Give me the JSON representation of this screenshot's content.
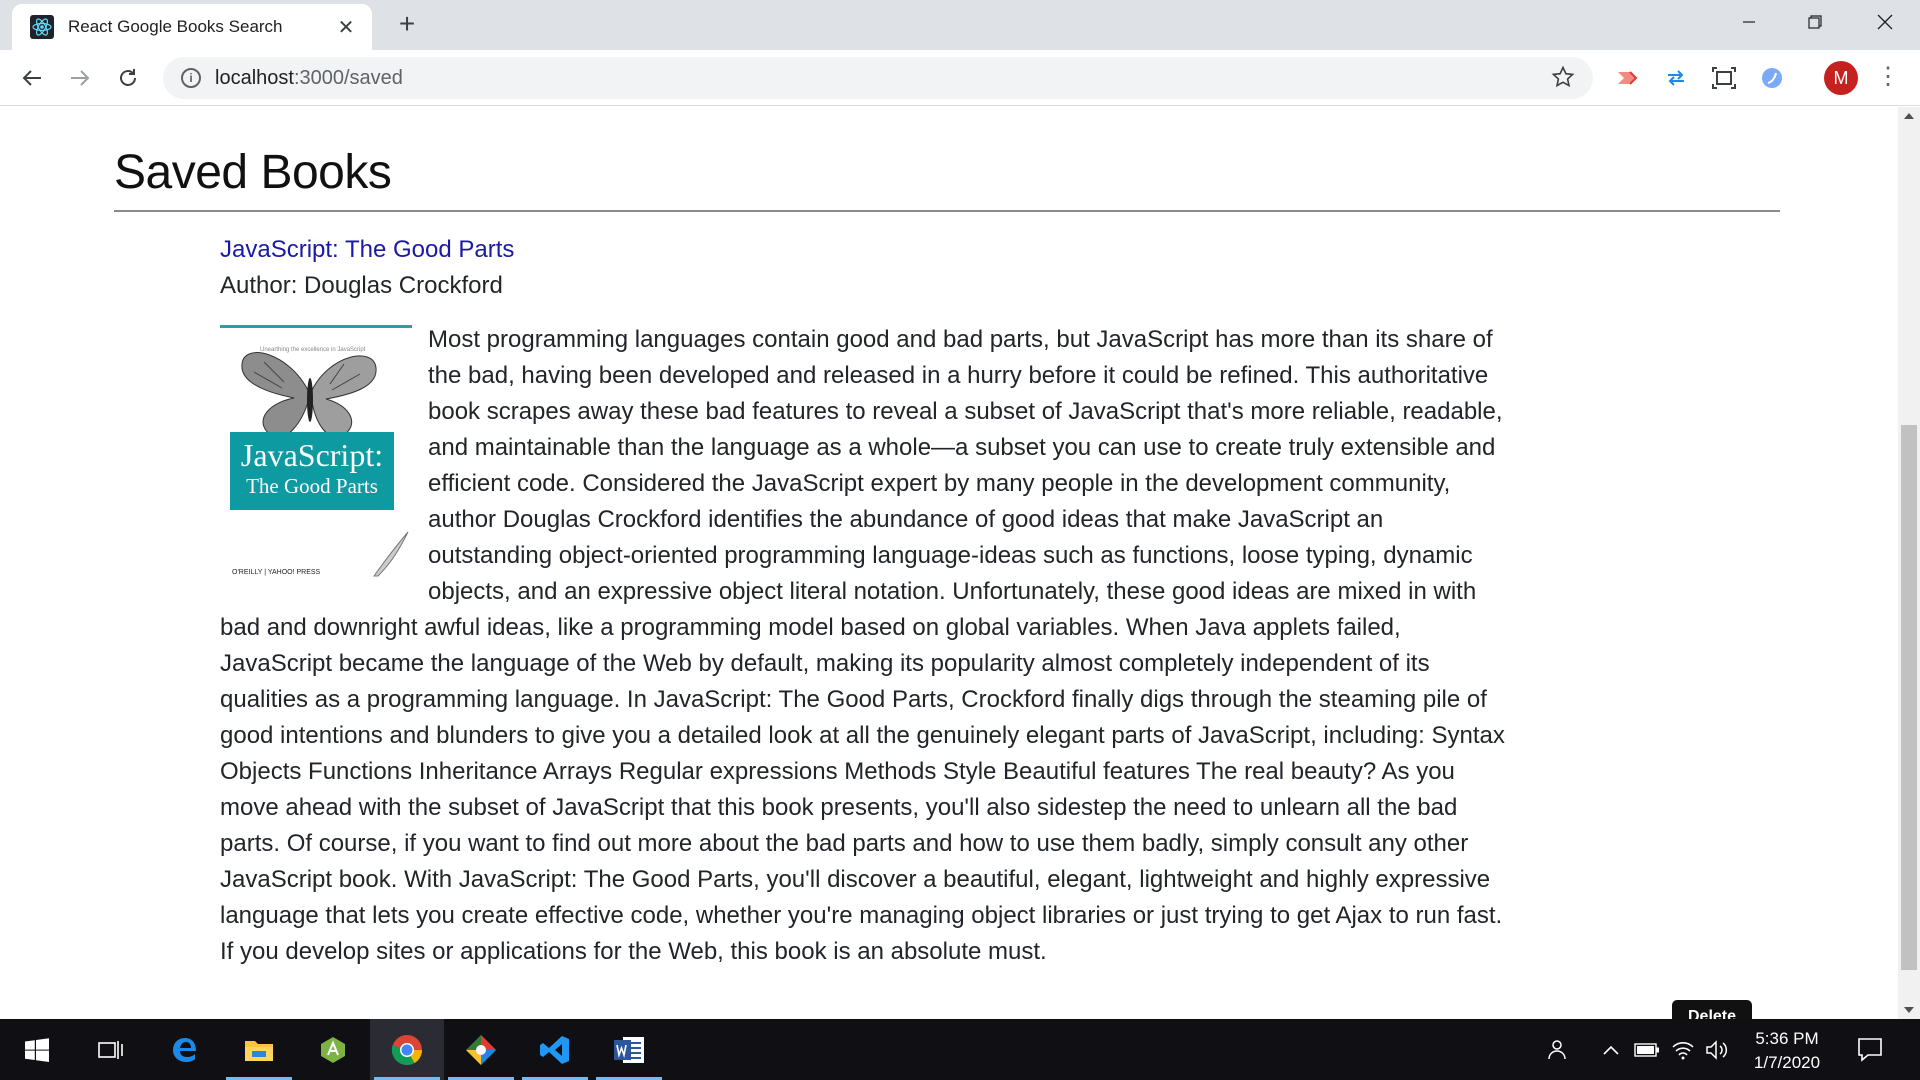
{
  "browser": {
    "tab_title": "React Google Books Search",
    "tab_close": "✕",
    "new_tab": "+",
    "url_host": "localhost",
    "url_path": ":3000/saved",
    "profile_initial": "M",
    "win_minimize": "—",
    "win_restore": "❐",
    "win_close": "✕"
  },
  "page": {
    "title": "Saved Books",
    "tooltip": "Delete"
  },
  "book": {
    "title": "JavaScript: The Good Parts",
    "author": "Author: Douglas Crockford",
    "cover": {
      "tagline": "Unearthing the excellence in JavaScript",
      "line1": "JavaScript:",
      "line2": "The Good Parts",
      "publisher": "O'REILLY | YAHOO! PRESS"
    },
    "description": "Most programming languages contain good and bad parts, but JavaScript has more than its share of the bad, having been developed and released in a hurry before it could be refined. This authoritative book scrapes away these bad features to reveal a subset of JavaScript that's more reliable, readable, and maintainable than the language as a whole—a subset you can use to create truly extensible and efficient code. Considered the JavaScript expert by many people in the development community, author Douglas Crockford identifies the abundance of good ideas that make JavaScript an outstanding object-oriented programming language-ideas such as functions, loose typing, dynamic objects, and an expressive object literal notation. Unfortunately, these good ideas are mixed in with bad and downright awful ideas, like a programming model based on global variables. When Java applets failed, JavaScript became the language of the Web by default, making its popularity almost completely independent of its qualities as a programming language. In JavaScript: The Good Parts, Crockford finally digs through the steaming pile of good intentions and blunders to give you a detailed look at all the genuinely elegant parts of JavaScript, including: Syntax Objects Functions Inheritance Arrays Regular expressions Methods Style Beautiful features The real beauty? As you move ahead with the subset of JavaScript that this book presents, you'll also sidestep the need to unlearn all the bad parts. Of course, if you want to find out more about the bad parts and how to use them badly, simply consult any other JavaScript book. With JavaScript: The Good Parts, you'll discover a beautiful, elegant, lightweight and highly expressive language that lets you create effective code, whether you're managing object libraries or just trying to get Ajax to run fast. If you develop sites or applications for the Web, this book is an absolute must."
  },
  "taskbar": {
    "time": "5:36 PM",
    "date": "1/7/2020",
    "apps": [
      "start-icon",
      "task-view-icon",
      "edge-icon",
      "file-explorer-icon",
      "android-studio-icon",
      "chrome-icon",
      "gitkraken-icon",
      "vscode-icon",
      "word-icon"
    ]
  },
  "colors": {
    "link": "#1a1aa6",
    "cover_teal": "#0e9aa1",
    "profile": "#c5221f",
    "taskbar": "#0f0f14"
  }
}
